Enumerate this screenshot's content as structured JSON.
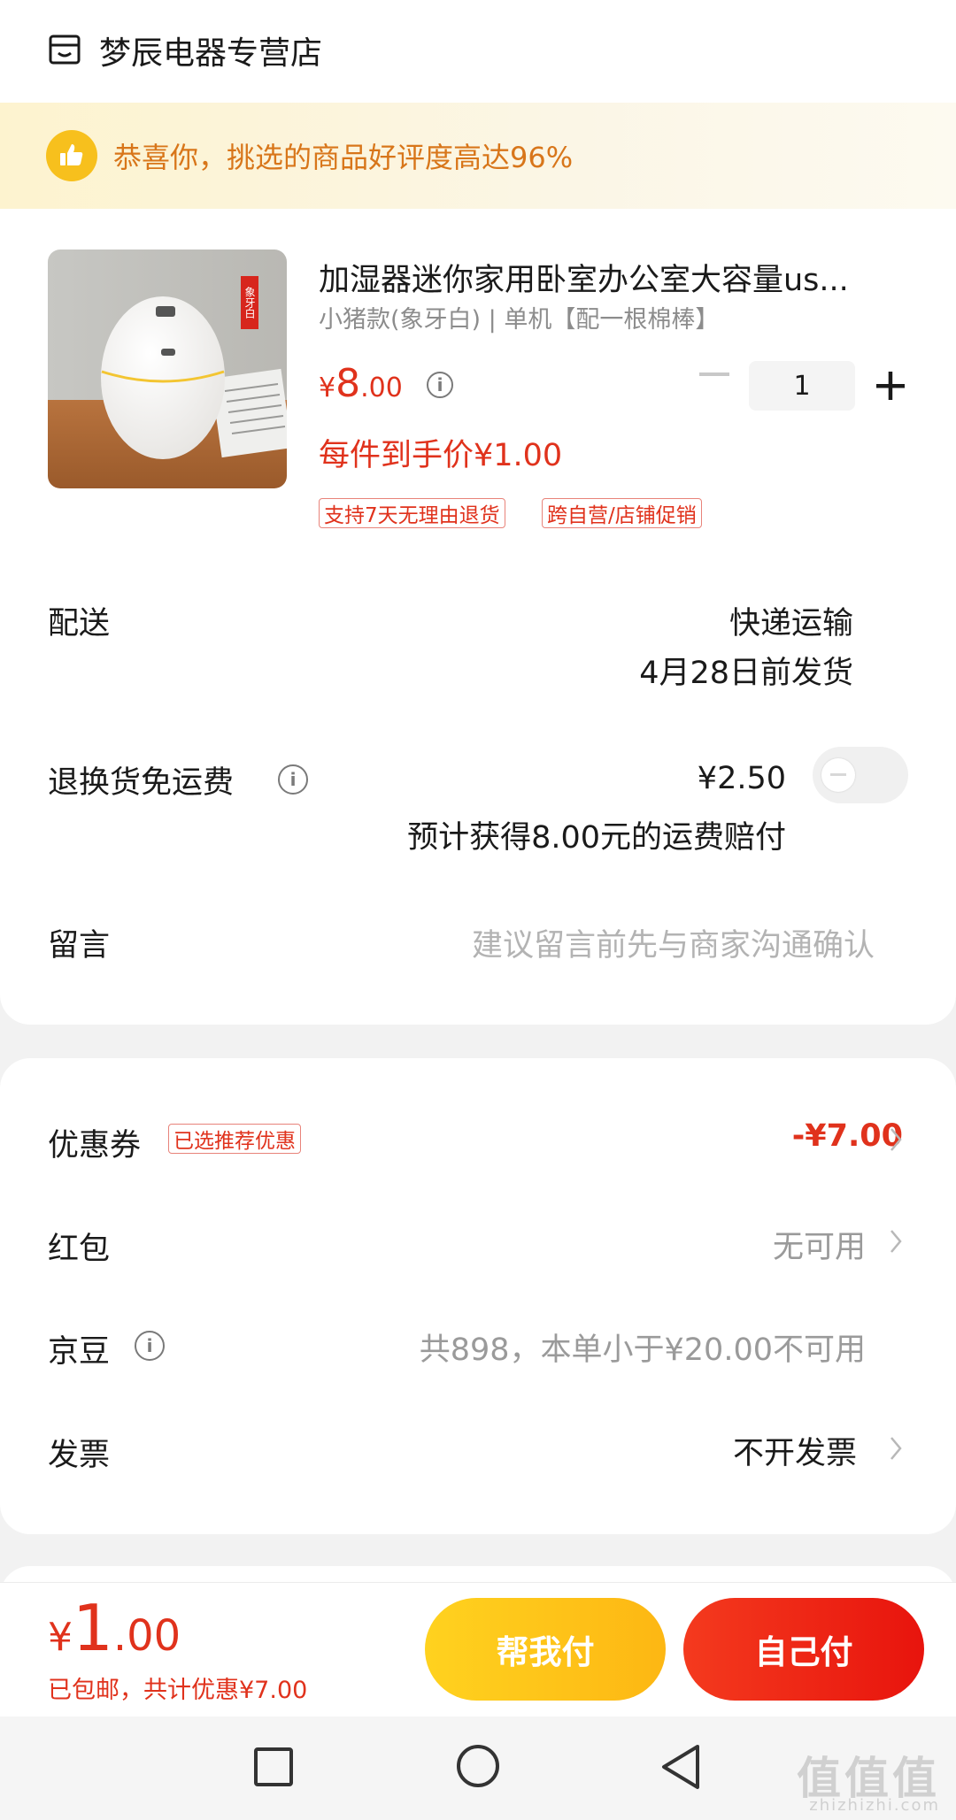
{
  "store": {
    "name": "梦辰电器专营店",
    "icon": "shop-icon"
  },
  "banner": {
    "text": "恭喜你，挑选的商品好评度高达96%",
    "icon": "thumbs-up-icon"
  },
  "product": {
    "title": "加湿器迷你家用卧室办公室大容量us...",
    "spec": "小猪款(象牙白) | 单机【配一根棉棒】",
    "image_label": "象牙白",
    "price_currency": "¥",
    "price_int": "8",
    "price_dec": ".00",
    "quantity": "1",
    "unit_price": "每件到手价¥1.00",
    "tags": [
      "支持7天无理由退货",
      "跨自营/店铺促销"
    ]
  },
  "delivery": {
    "label": "配送",
    "method": "快递运输",
    "date": "4月28日前发货"
  },
  "return_shipping": {
    "label": "退换货免运费",
    "price": "¥2.50",
    "note": "预计获得8.00元的运费赔付",
    "enabled": false
  },
  "message": {
    "label": "留言",
    "placeholder": "建议留言前先与商家沟通确认"
  },
  "coupon": {
    "label": "优惠券",
    "badge": "已选推荐优惠",
    "value": "-¥7.00"
  },
  "red_packet": {
    "label": "红包",
    "value": "无可用"
  },
  "jingdou": {
    "label": "京豆",
    "value": "共898，本单小于¥20.00不可用"
  },
  "invoice": {
    "label": "发票",
    "value": "不开发票"
  },
  "footer": {
    "currency": "¥",
    "total_int": "1",
    "total_dec": ".00",
    "subtext": "已包邮，共计优惠¥7.00",
    "help_pay": "帮我付",
    "self_pay": "自己付"
  },
  "watermark": {
    "text": "值值值",
    "sub": "zhizhizhi.com"
  },
  "colors": {
    "accent_red": "#e0321c",
    "banner_orange": "#d8761a",
    "help_btn": "#fdb713",
    "self_btn": "#e8140d"
  }
}
